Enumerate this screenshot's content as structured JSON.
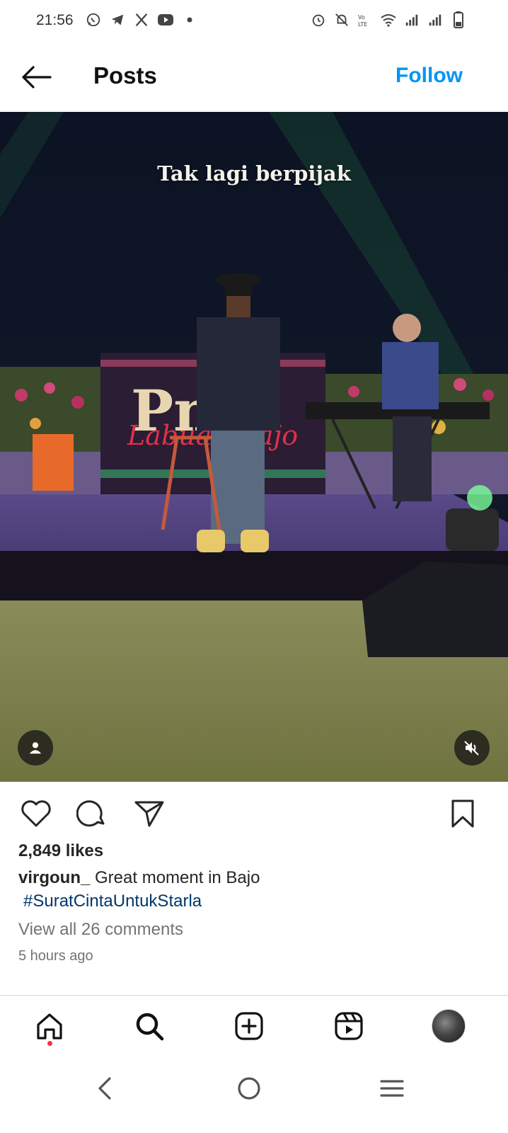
{
  "status_bar": {
    "time": "21:56",
    "left_icons": [
      "whatsapp-icon",
      "telegram-icon",
      "x-icon",
      "youtube-icon",
      "dot-icon"
    ],
    "right_icons": [
      "alarm-icon",
      "bell-off-icon",
      "volte-icon",
      "wifi-icon",
      "signal-icon",
      "signal-icon",
      "battery-icon"
    ]
  },
  "header": {
    "title": "Posts",
    "follow_label": "Follow"
  },
  "media": {
    "overlay_caption": "Tak lagi berpijak"
  },
  "post": {
    "likes": "2,849 likes",
    "username": "virgoun_",
    "caption": "Great moment in Bajo",
    "hashtag": "#SuratCintaUntukStarla",
    "view_comments": "View all 26 comments",
    "time_ago": "5 hours ago"
  },
  "bottom_nav": {
    "items": [
      "home-icon",
      "search-icon",
      "create-icon",
      "reels-icon",
      "profile-avatar"
    ]
  },
  "system_nav": {
    "items": [
      "back-icon",
      "home-circle-icon",
      "menu-icon"
    ]
  },
  "colors": {
    "accent": "#0095f6",
    "hashtag": "#00376b",
    "muted": "#737373",
    "notification": "#ff3040"
  }
}
